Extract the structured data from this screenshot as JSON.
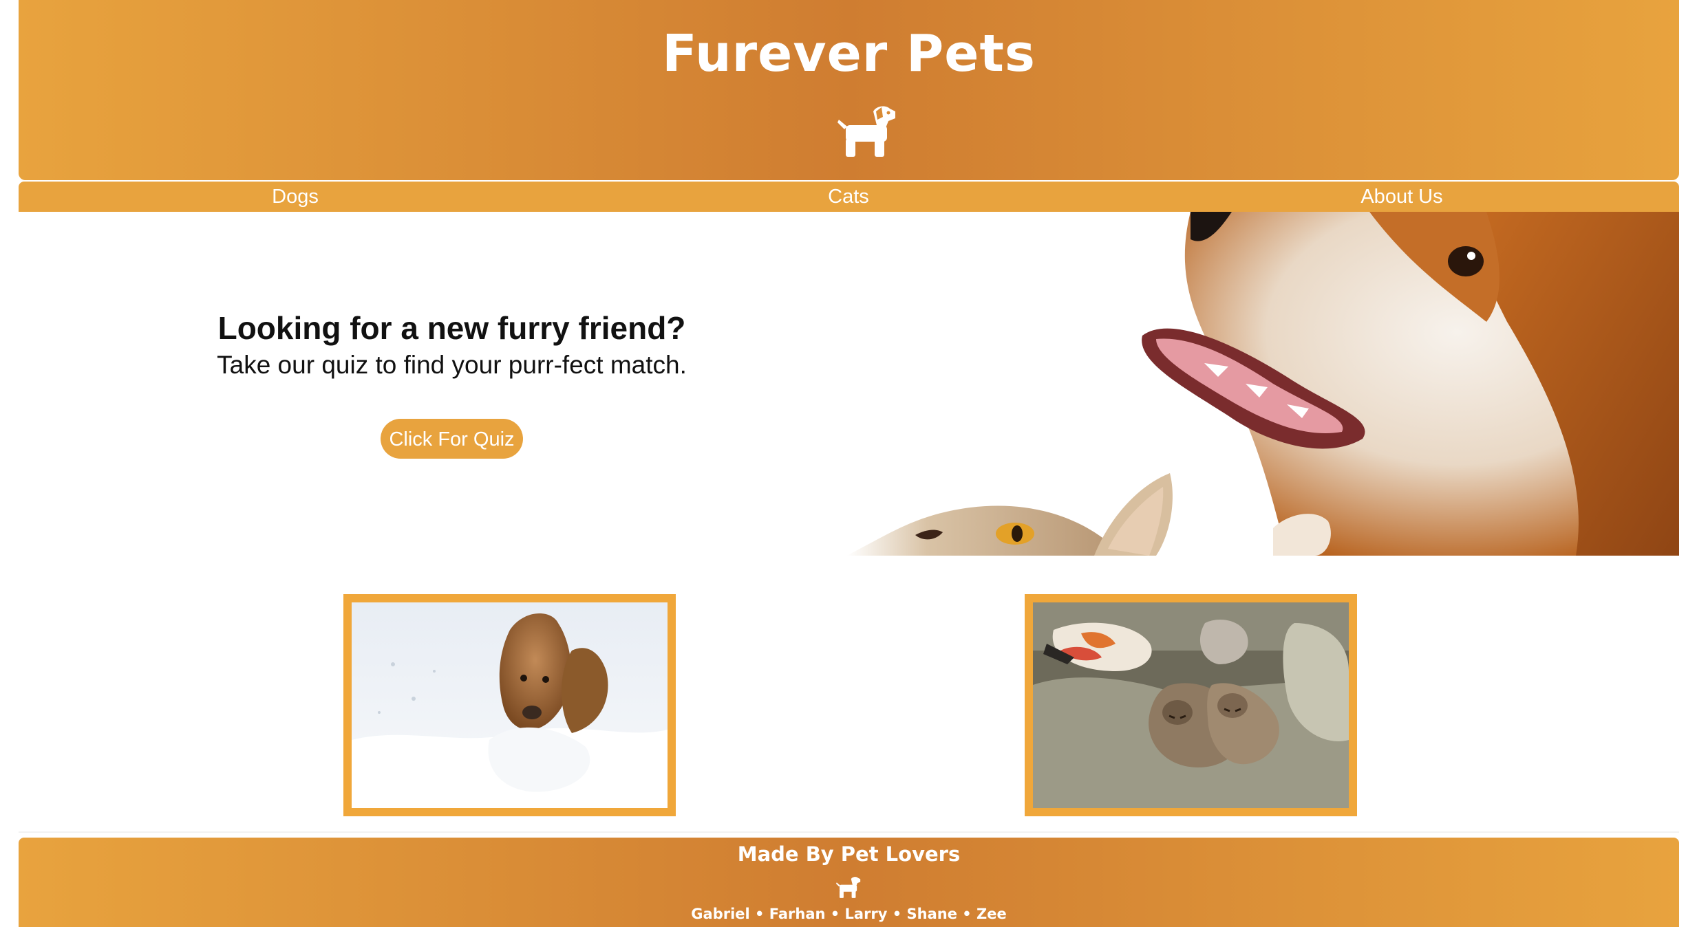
{
  "header": {
    "title": "Furever Pets",
    "logo_icon": "dog-icon"
  },
  "nav": {
    "items": [
      {
        "label": "Dogs"
      },
      {
        "label": "Cats"
      },
      {
        "label": "About Us"
      }
    ]
  },
  "hero": {
    "headline": "Looking for a new furry friend?",
    "subtitle": "Take our quiz to find your purr-fect match.",
    "quiz_button": "Click For Quiz",
    "image": "dog-and-cat-photo"
  },
  "gallery": {
    "images": [
      "dog-in-snow-photo",
      "kittens-on-couch-photo"
    ]
  },
  "footer": {
    "title": "Made By Pet Lovers",
    "icon": "dog-icon",
    "names": "Gabriel • Farhan • Larry • Shane • Zee"
  },
  "colors": {
    "accent": "#e8a33e",
    "accent_dark": "#cf7d31",
    "frame": "#f0a73a"
  }
}
